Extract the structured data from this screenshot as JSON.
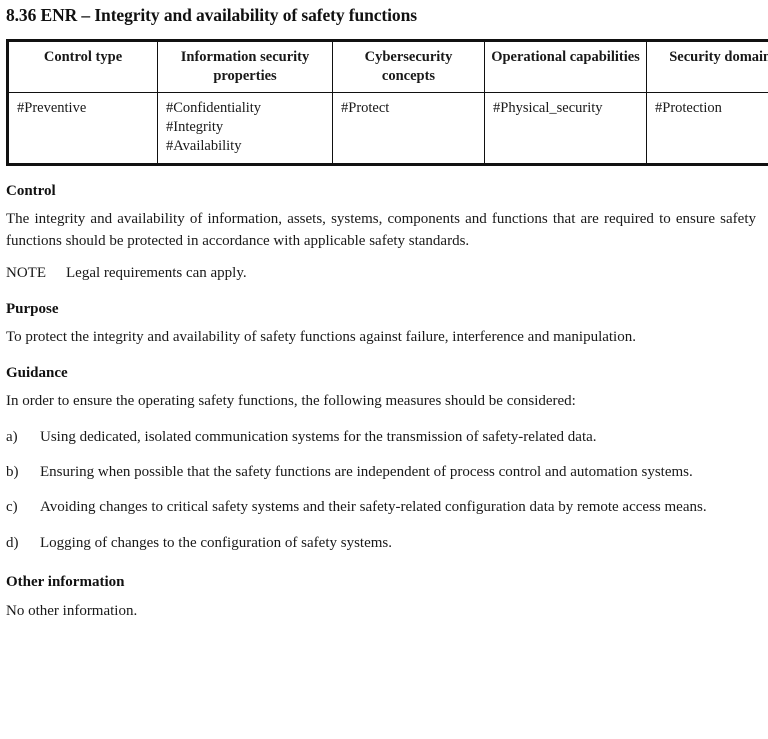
{
  "document": {
    "title": "8.36 ENR – Integrity and availability of safety functions"
  },
  "attributes_table": {
    "headers": [
      "Control type",
      "Information security properties",
      "Cybersecurity concepts",
      "Operational capabilities",
      "Security domains"
    ],
    "row": {
      "control_type": [
        "#Preventive"
      ],
      "information_security_properties": [
        "#Confidentiality",
        "#Integrity",
        "#Availability"
      ],
      "cybersecurity_concepts": [
        "#Protect"
      ],
      "operational_capabilities": [
        "#Physical_security"
      ],
      "security_domains": [
        "#Protection"
      ]
    }
  },
  "sections": {
    "control": {
      "heading": "Control",
      "text": "The integrity and availability of information, assets, systems, components and functions that are required to ensure safety functions should be protected in accordance with applicable safety standards.",
      "note_label": "NOTE",
      "note_text": "Legal requirements can apply."
    },
    "purpose": {
      "heading": "Purpose",
      "text": "To protect the integrity and availability of safety functions against failure, interference and manipulation."
    },
    "guidance": {
      "heading": "Guidance",
      "intro": "In order to ensure the operating safety functions, the following measures should be considered:",
      "items": [
        {
          "marker": "a)",
          "text": "Using dedicated, isolated communication systems for the transmission of safety-related data."
        },
        {
          "marker": "b)",
          "text": "Ensuring when possible that the safety functions are independent of process control and automation systems."
        },
        {
          "marker": "c)",
          "text": "Avoiding changes to critical safety systems and their safety-related configuration data by remote access means."
        },
        {
          "marker": "d)",
          "text": "Logging of changes to the configuration of safety systems."
        }
      ]
    },
    "other_information": {
      "heading": "Other information",
      "text": "No other information."
    }
  },
  "colors": {
    "text": "#191919",
    "border": "#111111",
    "background": "#ffffff"
  }
}
